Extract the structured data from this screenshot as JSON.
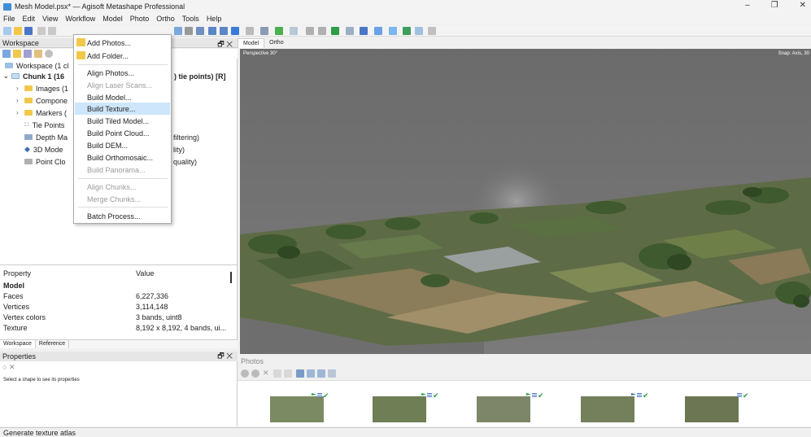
{
  "window": {
    "title": "Mesh Model.psx* — Agisoft Metashape Professional",
    "controls": [
      "–",
      "❐",
      "✕"
    ]
  },
  "menubar": [
    "File",
    "Edit",
    "View",
    "Workflow",
    "Model",
    "Photo",
    "Ortho",
    "Tools",
    "Help"
  ],
  "workflow_menu": {
    "items": [
      {
        "label": "Add Photos...",
        "enabled": true
      },
      {
        "label": "Add Folder...",
        "enabled": true
      },
      {
        "label": "Align Photos...",
        "enabled": true
      },
      {
        "label": "Align Laser Scans...",
        "enabled": false
      },
      {
        "label": "Build Model...",
        "enabled": true
      },
      {
        "label": "Build Texture...",
        "enabled": true,
        "highlighted": true
      },
      {
        "label": "Build Tiled Model...",
        "enabled": true
      },
      {
        "label": "Build Point Cloud...",
        "enabled": true
      },
      {
        "label": "Build DEM...",
        "enabled": true
      },
      {
        "label": "Build Orthomosaic...",
        "enabled": true
      },
      {
        "label": "Build Panorama...",
        "enabled": false
      },
      {
        "label": "Align Chunks...",
        "enabled": false
      },
      {
        "label": "Merge Chunks...",
        "enabled": false
      },
      {
        "label": "Batch Process...",
        "enabled": true
      }
    ]
  },
  "workspace": {
    "title": "Workspace",
    "float_icon": "🗗 ✕",
    "tree": {
      "root": "Workspace (1 cl",
      "chunk": "Chunk 1 (16",
      "chunk_suffix": ") tie points) [R]",
      "items": [
        {
          "label": "Images (1",
          "suffix": ""
        },
        {
          "label": "Compone",
          "suffix": ""
        },
        {
          "label": "Markers (",
          "suffix": ""
        },
        {
          "label": "Tie Points",
          "suffix": ""
        },
        {
          "label": "Depth Ma",
          "suffix": "filtering)"
        },
        {
          "label": "3D Mode",
          "suffix": "lity)"
        },
        {
          "label": "Point Clo",
          "suffix": "quality)"
        }
      ]
    },
    "properties_table": {
      "header_key": "Property",
      "header_value": "Value",
      "section": "Model",
      "rows": [
        {
          "key": "Faces",
          "value": "6,227,336"
        },
        {
          "key": "Vertices",
          "value": "3,114,148"
        },
        {
          "key": "Vertex colors",
          "value": "3 bands, uint8"
        },
        {
          "key": "Texture",
          "value": "8,192 x 8,192, 4 bands, ui..."
        }
      ]
    },
    "tabs": [
      "Workspace",
      "Reference"
    ]
  },
  "properties_panel": {
    "title": "Properties",
    "float_icon": "🗗 ✕",
    "hint": "Select a shape to see its properties"
  },
  "viewport": {
    "tabs": [
      "Model",
      "Ortho"
    ],
    "perspective_label": "Perspective 30°",
    "snap_label": "Snap: Axis, 30"
  },
  "photos": {
    "title": "Photos",
    "thumbnail_count": 5
  },
  "status": "Generate texture atlas"
}
